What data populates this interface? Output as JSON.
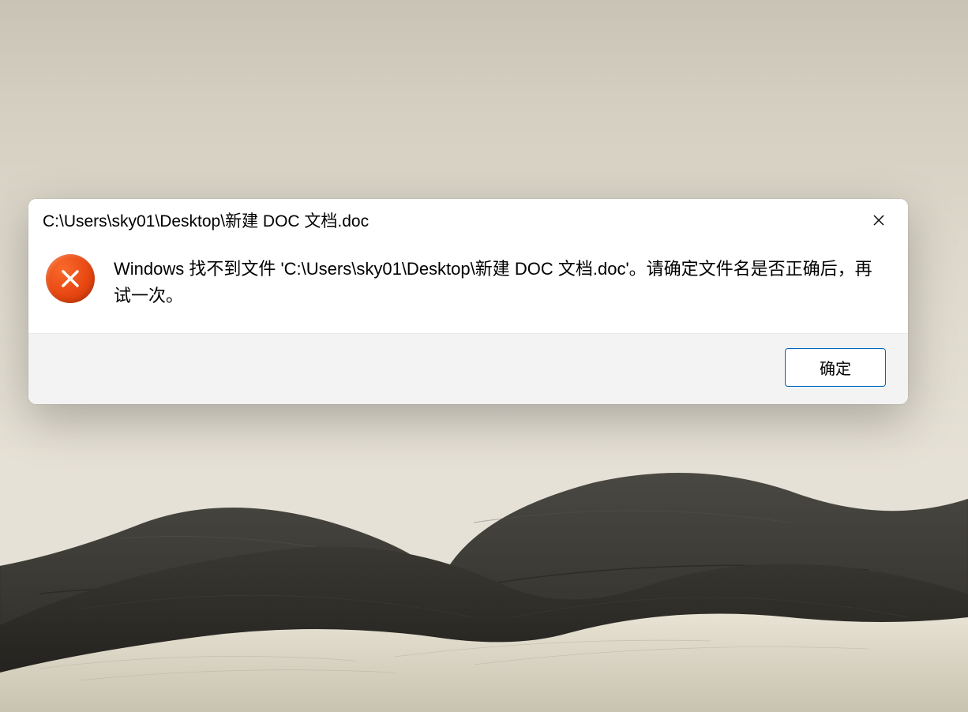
{
  "dialog": {
    "title": "C:\\Users\\sky01\\Desktop\\新建 DOC 文档.doc",
    "message": "Windows 找不到文件 'C:\\Users\\sky01\\Desktop\\新建 DOC 文档.doc'。请确定文件名是否正确后，再试一次。",
    "ok_label": "确定"
  },
  "icons": {
    "error": "error-x-icon",
    "close": "close-icon"
  },
  "colors": {
    "error_icon": "#e64510",
    "button_border": "#0067c0",
    "footer_bg": "#f3f3f3"
  }
}
